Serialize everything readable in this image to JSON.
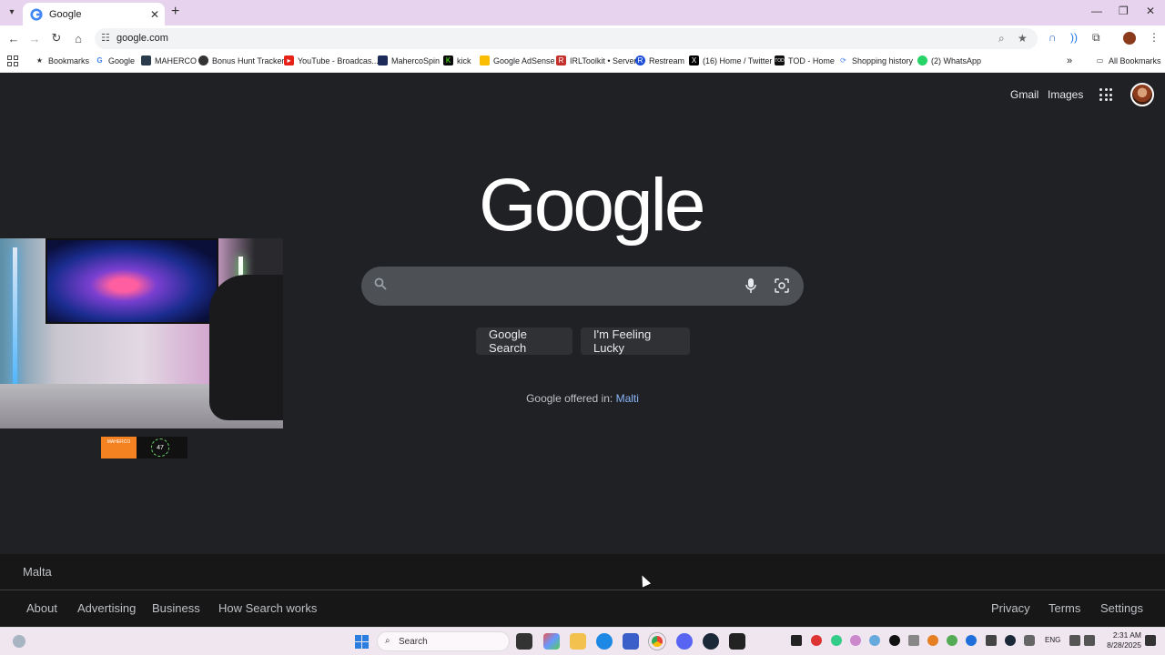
{
  "browser": {
    "tab": {
      "title": "Google"
    },
    "url": "google.com",
    "bookmarks": [
      {
        "label": "Bookmarks",
        "icon": "star-icon"
      },
      {
        "label": "Google",
        "icon": "google-icon"
      },
      {
        "label": "MAHERCO",
        "icon": "maherco-icon"
      },
      {
        "label": "Bonus Hunt Tracker",
        "icon": "chrome-icon"
      },
      {
        "label": "YouTube - Broadcas...",
        "icon": "youtube-icon"
      },
      {
        "label": "MahercoSpin",
        "icon": "mahercospin-icon"
      },
      {
        "label": "kick",
        "icon": "kick-icon"
      },
      {
        "label": "Google AdSense",
        "icon": "adsense-icon"
      },
      {
        "label": "IRLToolkit • Server",
        "icon": "irltoolkit-icon"
      },
      {
        "label": "Restream",
        "icon": "restream-icon"
      },
      {
        "label": "(16) Home / Twitter",
        "icon": "x-icon"
      },
      {
        "label": "TOD - Home",
        "icon": "tod-icon"
      },
      {
        "label": "Shopping history",
        "icon": "shopping-icon"
      },
      {
        "label": "(2) WhatsApp",
        "icon": "whatsapp-icon"
      }
    ],
    "all_bookmarks": "All Bookmarks"
  },
  "google": {
    "top_links": {
      "gmail": "Gmail",
      "images": "Images"
    },
    "logo": "Google",
    "search": {
      "value": ""
    },
    "buttons": {
      "search": "Google Search",
      "lucky": "I'm Feeling Lucky"
    },
    "offered_prefix": "Google offered in:",
    "offered_language": "Malti",
    "footer": {
      "country": "Malta",
      "left": [
        "About",
        "Advertising",
        "Business",
        "How Search works"
      ],
      "right": [
        "Privacy",
        "Terms",
        "Settings"
      ]
    }
  },
  "overlay": {
    "badge_brand": "MAHERCO",
    "badge_count": "47"
  },
  "taskbar": {
    "search_label": "Search",
    "language": "ENG",
    "time": "2:31 AM",
    "date": "8/28/2025"
  },
  "colors": {
    "page_bg": "#202124",
    "link_blue": "#8ab4f8",
    "tabstrip": "#e8d3ee"
  }
}
